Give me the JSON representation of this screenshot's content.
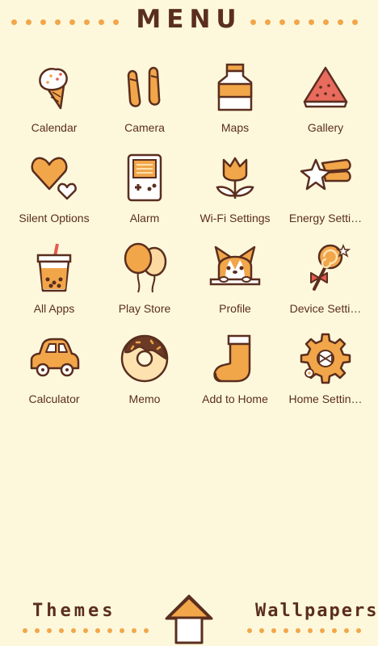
{
  "header": {
    "title": "MENU"
  },
  "apps": [
    {
      "label": "Calendar",
      "icon": "ice-cream-icon"
    },
    {
      "label": "Camera",
      "icon": "shoes-icon"
    },
    {
      "label": "Maps",
      "icon": "milk-bottle-icon"
    },
    {
      "label": "Gallery",
      "icon": "watermelon-icon"
    },
    {
      "label": "Silent Options",
      "icon": "hearts-icon"
    },
    {
      "label": "Alarm",
      "icon": "game-console-icon"
    },
    {
      "label": "Wi-Fi Settings",
      "icon": "tulip-icon"
    },
    {
      "label": "Energy Setti…",
      "icon": "shooting-star-icon"
    },
    {
      "label": "All Apps",
      "icon": "bubble-tea-icon"
    },
    {
      "label": "Play Store",
      "icon": "balloons-icon"
    },
    {
      "label": "Profile",
      "icon": "corgi-icon"
    },
    {
      "label": "Device Setti…",
      "icon": "lollipop-icon"
    },
    {
      "label": "Calculator",
      "icon": "car-icon"
    },
    {
      "label": "Memo",
      "icon": "donut-icon"
    },
    {
      "label": "Add to Home",
      "icon": "sock-icon"
    },
    {
      "label": "Home Settin…",
      "icon": "gear-bow-icon"
    }
  ],
  "footer": {
    "themes_label": "Themes",
    "wallpapers_label": "Wallpapers",
    "home_icon": "home-arrow-icon"
  },
  "colors": {
    "background": "#FDF8DC",
    "accent": "#F2A64A",
    "text": "#5A2E1E"
  }
}
